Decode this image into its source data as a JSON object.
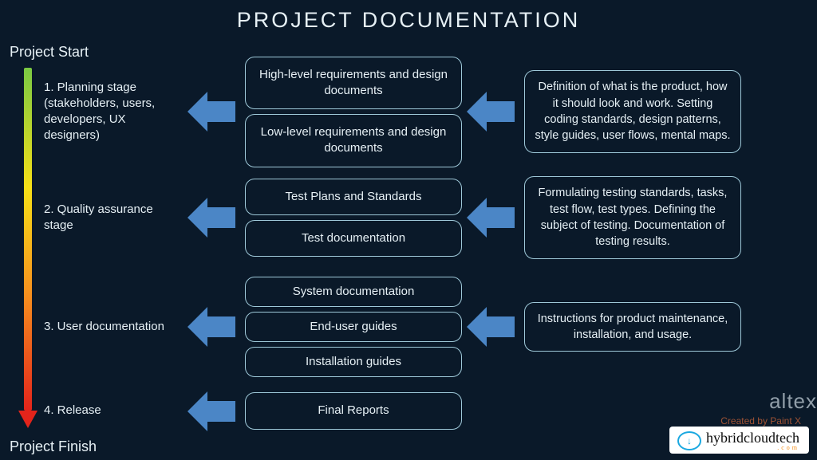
{
  "title": "PROJECT DOCUMENTATION",
  "timeline": {
    "start_label": "Project Start",
    "finish_label": "Project Finish"
  },
  "rows": [
    {
      "stage": "1. Planning stage (stakeholders, users, developers, UX designers)",
      "mid": [
        "High-level requirements and design documents",
        "Low-level requirements and design documents"
      ],
      "right": "Definition of what is the product, how it should look and work. Setting coding standards, design patterns, style guides, user flows, mental maps."
    },
    {
      "stage": "2. Quality assurance stage",
      "mid": [
        "Test Plans and Standards",
        "Test documentation"
      ],
      "right": "Formulating testing standards, tasks, test flow, test types. Defining the subject of testing. Documentation of testing results."
    },
    {
      "stage": "3. User documentation",
      "mid": [
        "System documentation",
        "End-user guides",
        "Installation guides"
      ],
      "right": "Instructions for product maintenance, installation, and usage."
    },
    {
      "stage": "4. Release",
      "mid": [
        "Final Reports"
      ],
      "right": null
    }
  ],
  "footer": {
    "watermark": "Created by Paint X",
    "logo_text": "hybridcloudtech",
    "logo_sub": ".com",
    "bg_brand": "altex"
  }
}
